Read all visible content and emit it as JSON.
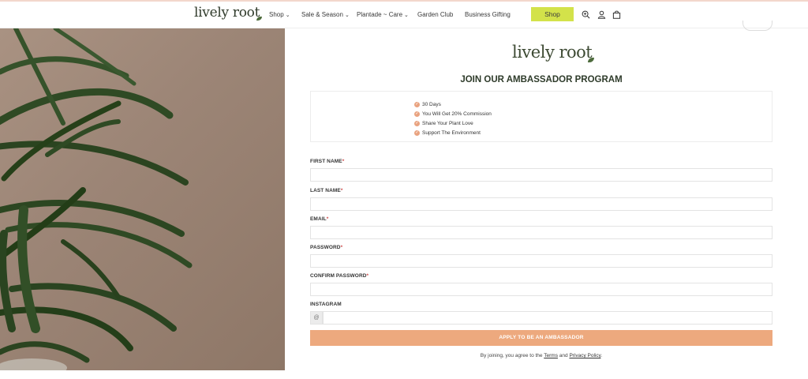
{
  "header": {
    "logo": "lively root",
    "nav": [
      {
        "label": "Shop",
        "dropdown": true
      },
      {
        "label": "Sale & Season",
        "dropdown": true
      },
      {
        "label": "Plantade ~ Care",
        "dropdown": true
      },
      {
        "label": "Garden Club",
        "dropdown": false
      },
      {
        "label": "Business Gifting",
        "dropdown": false
      }
    ],
    "shop_button": "Shop",
    "icons": [
      "zoom-search-icon",
      "user-icon",
      "bag-icon"
    ]
  },
  "main": {
    "logo": "lively root",
    "headline": "JOIN OUR AMBASSADOR PROGRAM",
    "benefits": [
      "30 Days",
      "You Will Get 20% Commission",
      "Share Your Plant Love",
      "Support The Environment"
    ],
    "form": {
      "first_name_label": "FIRST NAME",
      "last_name_label": "LAST NAME",
      "email_label": "EMAIL",
      "password_label": "PASSWORD",
      "confirm_password_label": "CONFIRM PASSWORD",
      "instagram_label": "INSTAGRAM",
      "required_mark": "*",
      "instagram_prefix": "@",
      "submit_label": "APPLY TO BE AN AMBASSADOR"
    },
    "agreement": {
      "prefix": "By joining, you agree to the",
      "terms": "Terms",
      "and": "and",
      "privacy": "Privacy Policy",
      "suffix": "."
    }
  },
  "colors": {
    "shop_button": "#d3e24a",
    "submit_button": "#eda97e",
    "check": "#e9a380",
    "headline": "#2e3b2a"
  }
}
